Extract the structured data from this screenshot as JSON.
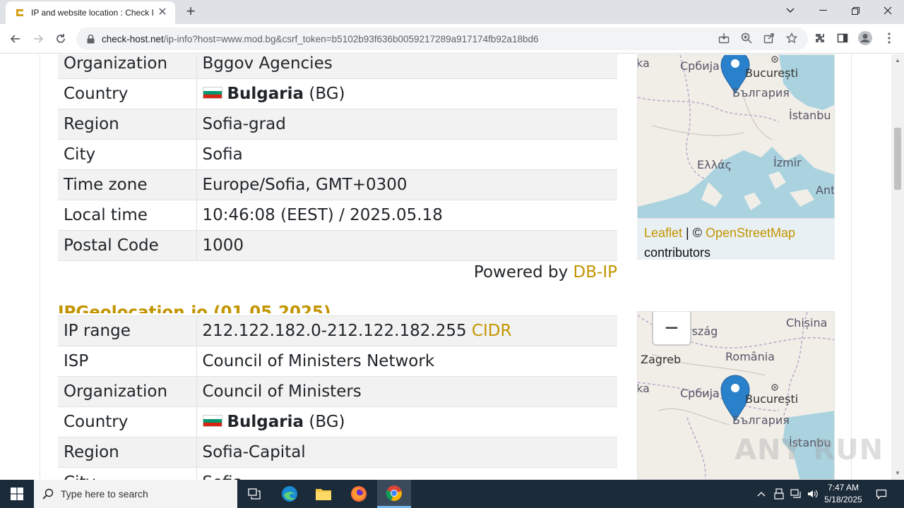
{
  "browser": {
    "tab_title": "IP and website location : Check I",
    "url_host": "check-host.net",
    "url_rest": "/ip-info?host=www.mod.bg&csrf_token=b5102b93f636b0059217289a917174fb92a18bd6"
  },
  "table1": {
    "rows": [
      {
        "key": "Organization",
        "value": "Bggov Agencies"
      },
      {
        "key": "Country",
        "country": "Bulgaria",
        "code": "(BG)"
      },
      {
        "key": "Region",
        "value": "Sofia-grad"
      },
      {
        "key": "City",
        "value": "Sofia"
      },
      {
        "key": "Time zone",
        "value": "Europe/Sofia, GMT+0300"
      },
      {
        "key": "Local time",
        "value": "10:46:08 (EEST) / 2025.05.18"
      },
      {
        "key": "Postal Code",
        "value": "1000"
      }
    ]
  },
  "powered": {
    "prefix": "Powered by ",
    "link": "DB-IP"
  },
  "section2": {
    "heading": "IPGeolocation.io (01.05.2025)"
  },
  "table2": {
    "rows": [
      {
        "key": "IP range",
        "value": "212.122.182.0-212.122.182.255",
        "link": "CIDR"
      },
      {
        "key": "ISP",
        "value": "Council of Ministers Network"
      },
      {
        "key": "Organization",
        "value": "Council of Ministers"
      },
      {
        "key": "Country",
        "country": "Bulgaria",
        "code": "(BG)"
      },
      {
        "key": "Region",
        "value": "Sofia-Capital"
      },
      {
        "key": "City",
        "value": "Sofia"
      }
    ]
  },
  "map1": {
    "labels": {
      "serbia": "Србија",
      "bucharest": "București",
      "bulgaria": "България",
      "istanbul": "İstanbu",
      "greece": "Ελλάς",
      "izmir": "İzmir",
      "antalya": "Ant"
    },
    "attribution": {
      "leaflet": "Leaflet",
      "sep": " | © ",
      "osm": "OpenStreetMap",
      "contrib": "contributors"
    }
  },
  "map2": {
    "zoom_out": "−",
    "labels": {
      "hungary": "rszág",
      "chisinau": "Chișina",
      "romania": "România",
      "zagreb": "Zagreb",
      "serbia": "Србија",
      "ka": "ka",
      "bucharest": "București",
      "bulgaria": "България",
      "istanbul": "İstanbu"
    }
  },
  "map1_ka": "ka",
  "watermark": "ANY RUN",
  "taskbar": {
    "search_placeholder": "Type here to search",
    "time": "7:47 AM",
    "date": "5/18/2025"
  },
  "colors": {
    "accent": "#c29500",
    "marker": "#2a81cb",
    "taskbar": "#1c2b3a"
  }
}
